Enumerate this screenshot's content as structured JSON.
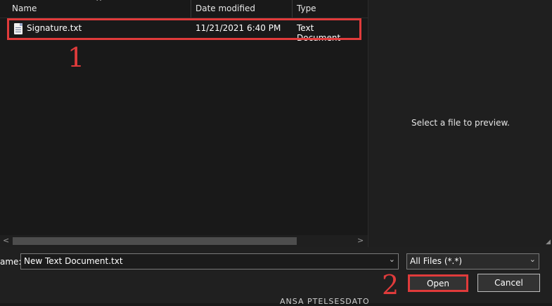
{
  "columns": {
    "name": "Name",
    "date_modified": "Date modified",
    "type": "Type"
  },
  "files": [
    {
      "name": "Signature.txt",
      "date_modified": "11/21/2021 6:40 PM",
      "type": "Text Document",
      "icon": "text-file-icon"
    }
  ],
  "annotations": {
    "step1": "1",
    "step2": "2",
    "color": "#e03b3b"
  },
  "preview": {
    "message": "Select a file to preview."
  },
  "file_name": {
    "label": "ame:",
    "value": "New Text Document.txt"
  },
  "file_type": {
    "selected": "All Files (*.*)"
  },
  "buttons": {
    "open": "Open",
    "cancel": "Cancel"
  },
  "clipped_text": "ANSA PTELSESDATO",
  "colors": {
    "background": "#191919",
    "accent_highlight": "#e03b3b"
  }
}
